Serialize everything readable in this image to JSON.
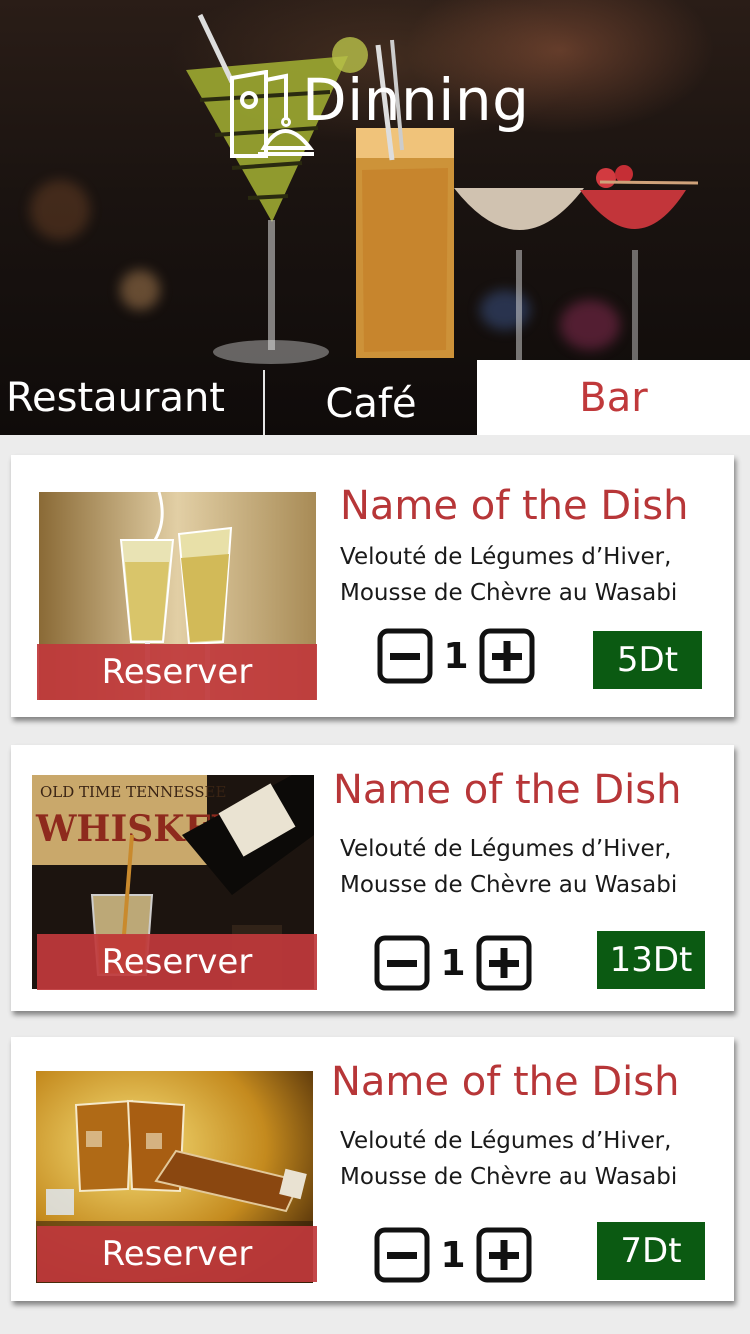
{
  "header": {
    "title": "Dinning",
    "icon": "menu-cloche-icon"
  },
  "tabs": [
    {
      "label": "Restaurant",
      "active": false
    },
    {
      "label": "Café",
      "active": false
    },
    {
      "label": "Bar",
      "active": true
    }
  ],
  "colors": {
    "accent": "#c0393b",
    "price_bg": "#0b5a12",
    "active_tab_bg": "#ffffff"
  },
  "items": [
    {
      "name": "Name of the Dish",
      "desc_line1": "Velouté de Légumes d’Hiver,",
      "desc_line2": "Mousse de Chèvre au Wasabi",
      "quantity": "1",
      "price": "5Dt",
      "reserve_label": "Reserver",
      "photo": "champagne-toast"
    },
    {
      "name": "Name of the Dish",
      "desc_line1": "Velouté de Légumes d’Hiver,",
      "desc_line2": "Mousse de Chèvre au Wasabi",
      "quantity": "1",
      "price": "13Dt",
      "reserve_label": "Reserver",
      "photo": "whiskey-pour"
    },
    {
      "name": "Name of the Dish",
      "desc_line1": "Velouté de Légumes d’Hiver,",
      "desc_line2": "Mousse de Chèvre au Wasabi",
      "quantity": "1",
      "price": "7Dt",
      "reserve_label": "Reserver",
      "photo": "whiskey-glasses"
    }
  ]
}
